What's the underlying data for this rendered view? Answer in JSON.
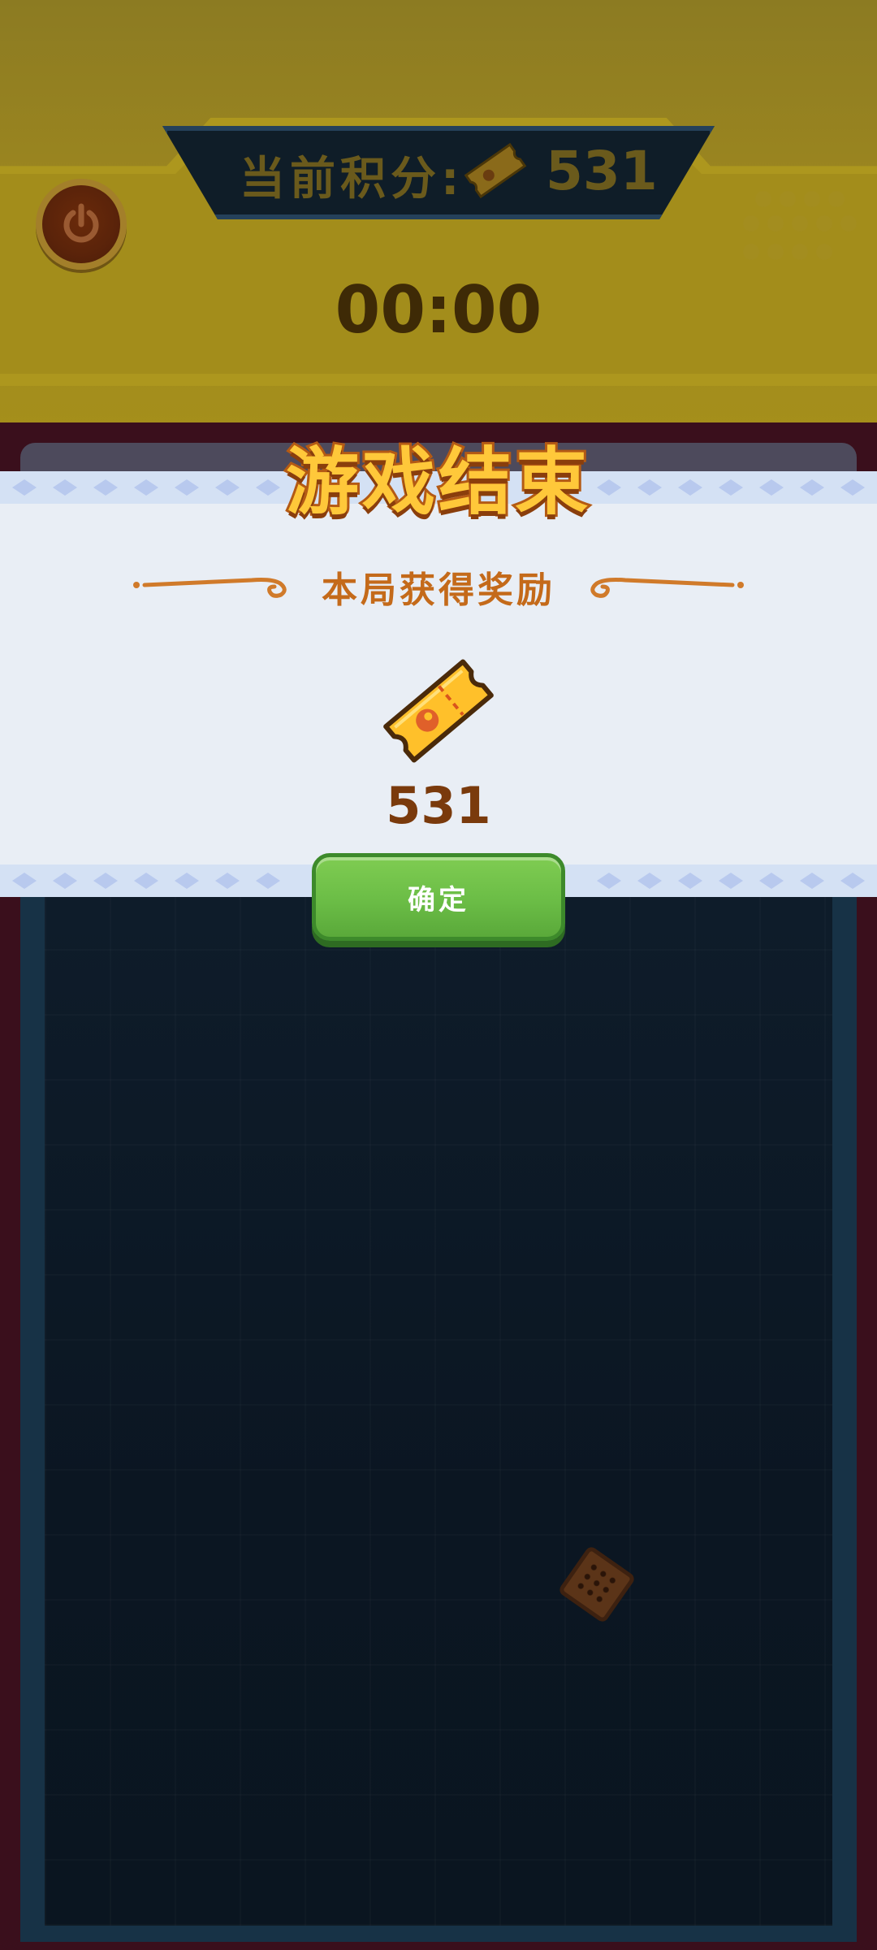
{
  "header": {
    "score_label": "当前积分:",
    "score_value": "531",
    "timer": "00:00",
    "power_icon": "power-icon",
    "ticket_icon": "ticket-icon"
  },
  "modal": {
    "title": "游戏结束",
    "subtitle": "本局获得奖励",
    "reward_icon": "ticket-icon",
    "reward_value": "531",
    "confirm_label": "确定"
  },
  "playfield": {
    "item_icon": "biscuit-icon"
  },
  "colors": {
    "title_fill": "#ffc83a",
    "title_stroke": "#b45a14",
    "subtitle": "#c46a1a",
    "reward_value": "#7a3a0c",
    "confirm_button": "#6bbd46",
    "modal_bg": "#e9eef5"
  }
}
